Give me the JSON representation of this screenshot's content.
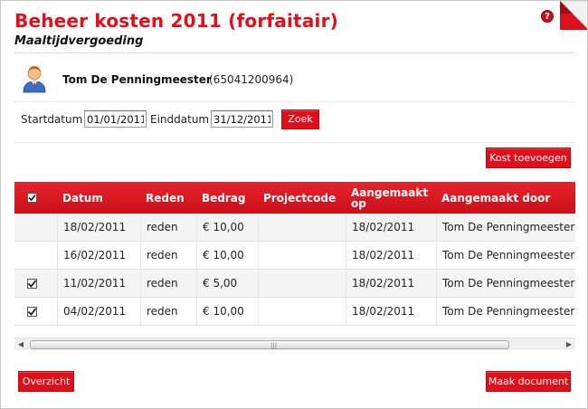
{
  "page": {
    "title": "Beheer kosten 2011 (forfaitair)",
    "subtitle": "Maaltijdvergoeding",
    "help_icon": "help-icon",
    "help_glyph": "?"
  },
  "user": {
    "avatar_icon": "user-avatar-icon",
    "name": "Tom De Penningmeester",
    "id": "(65041200964)"
  },
  "search": {
    "start_label": "Startdatum",
    "start_value": "01/01/2011",
    "end_label": "Einddatum",
    "end_value": "31/12/2011",
    "search_button": "Zoek"
  },
  "actions": {
    "add_cost_button": "Kost toevoegen",
    "overview_button": "Overzicht",
    "make_document_button": "Maak document"
  },
  "table": {
    "columns": [
      "Datum",
      "Reden",
      "Bedrag",
      "Projectcode",
      "Aangemaakt op",
      "Aangemaakt door"
    ],
    "header_checked": true,
    "rows": [
      {
        "checked": false,
        "datum": "18/02/2011",
        "reden": "reden",
        "bedrag": "€ 10,00",
        "projectcode": "",
        "aangemaakt_op": "18/02/2011",
        "aangemaakt_door": "Tom De Penningmeester"
      },
      {
        "checked": false,
        "datum": "16/02/2011",
        "reden": "reden",
        "bedrag": "€ 10,00",
        "projectcode": "",
        "aangemaakt_op": "18/02/2011",
        "aangemaakt_door": "Tom De Penningmeester"
      },
      {
        "checked": true,
        "datum": "11/02/2011",
        "reden": "reden",
        "bedrag": "€ 5,00",
        "projectcode": "",
        "aangemaakt_op": "18/02/2011",
        "aangemaakt_door": "Tom De Penningmeester"
      },
      {
        "checked": true,
        "datum": "04/02/2011",
        "reden": "reden",
        "bedrag": "€ 10,00",
        "projectcode": "",
        "aangemaakt_op": "18/02/2011",
        "aangemaakt_door": "Tom De Penningmeester"
      }
    ]
  },
  "colors": {
    "accent": "#e0101a",
    "header_bg": "#d61a22",
    "row_alt": "#f4f4f4"
  }
}
